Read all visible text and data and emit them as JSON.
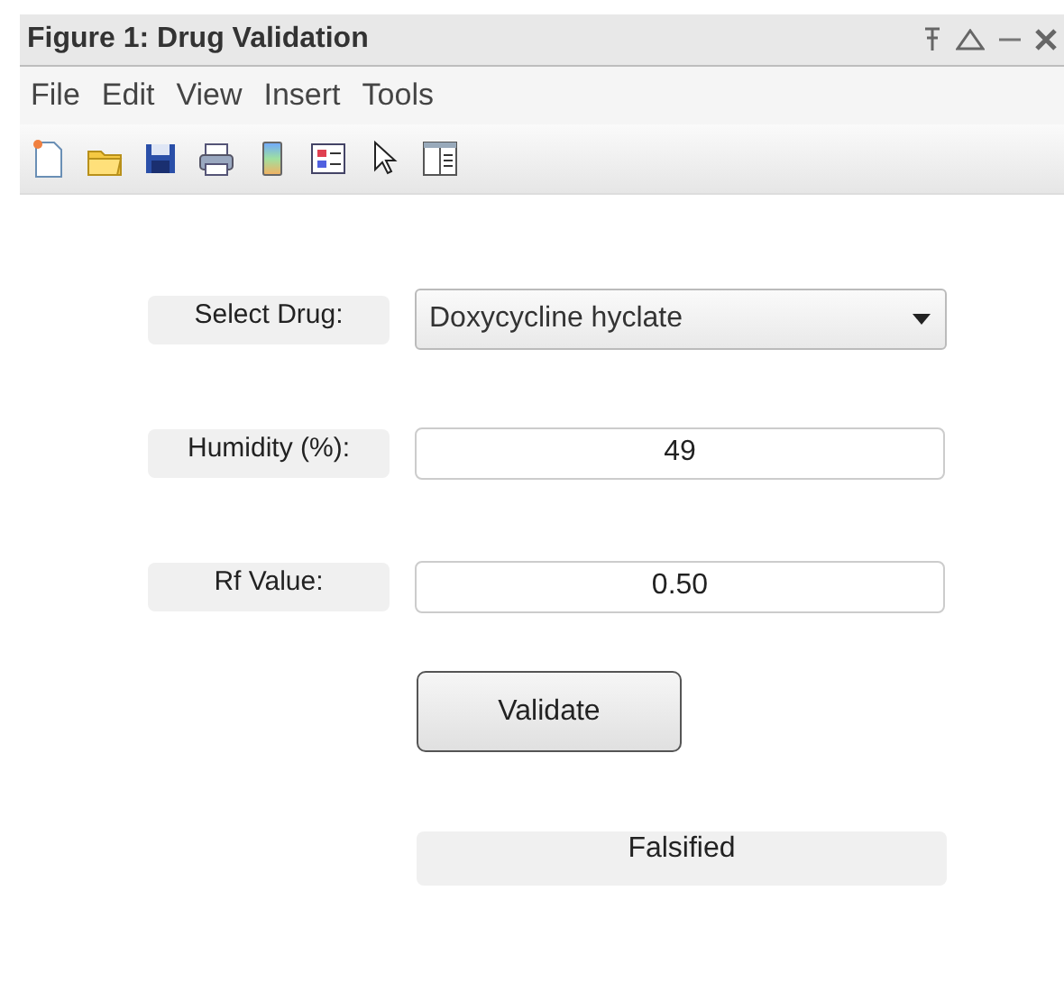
{
  "window": {
    "title": "Figure 1: Drug Validation"
  },
  "menu": [
    "File",
    "Edit",
    "View",
    "Insert",
    "Tools"
  ],
  "fields": [
    {
      "kind": "dropdown",
      "label": "Select Drug:",
      "value": "Doxycycline hyclate"
    },
    {
      "kind": "input",
      "label": "Humidity (%):",
      "value": "49"
    },
    {
      "kind": "input",
      "label": "Rf Value:",
      "value": "0.50"
    }
  ],
  "button": "Validate",
  "result": "Falsified"
}
